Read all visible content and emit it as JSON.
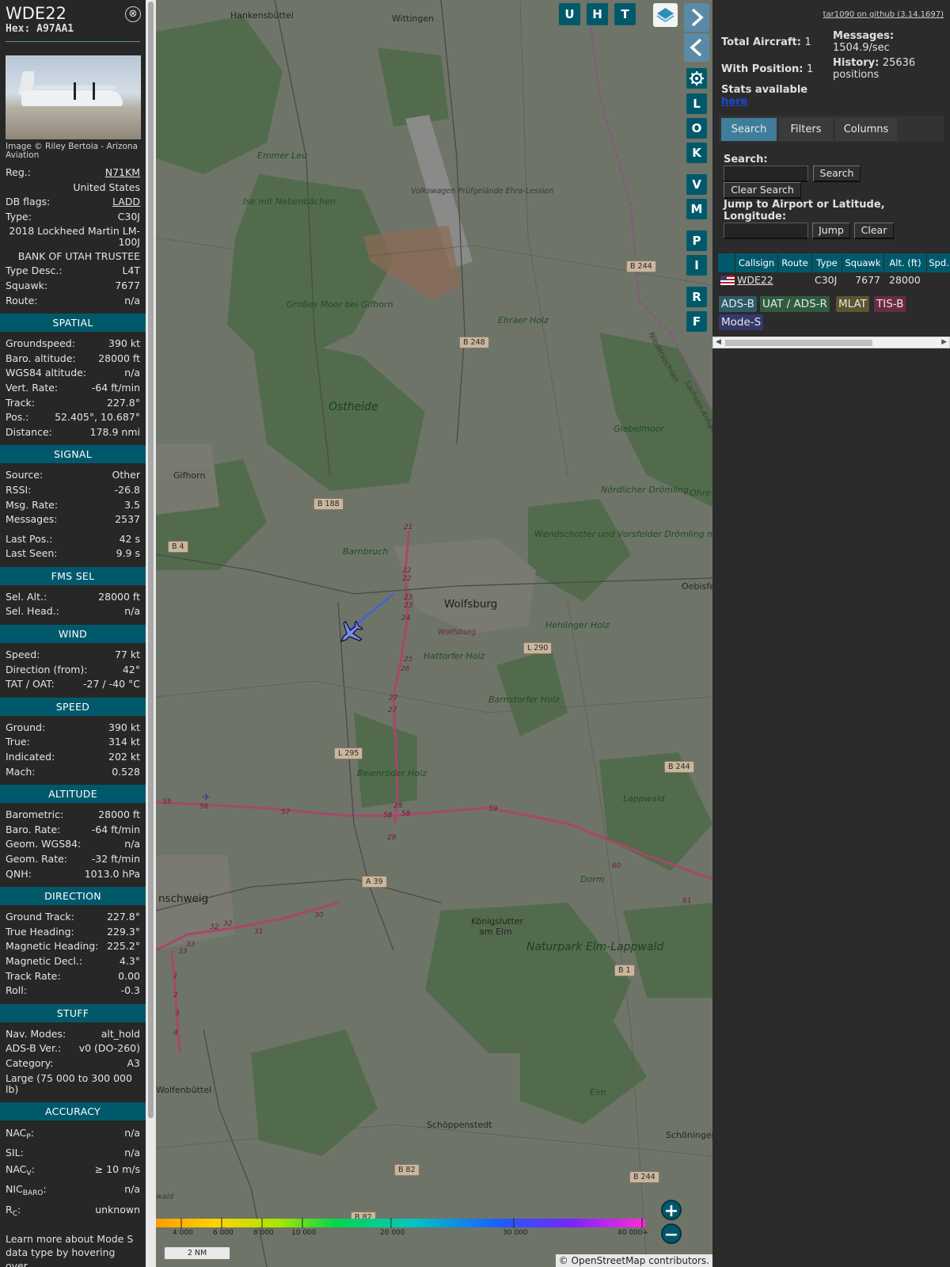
{
  "info": {
    "callsign": "WDE22",
    "hex": "Hex: A97AA1",
    "close_glyph": "⊗",
    "photo_credit": "Image © Riley Bertoia - Arizona Aviation",
    "top": [
      {
        "label": "Reg.:",
        "value": "N71KM",
        "link": true
      },
      {
        "label": "",
        "value": "United States"
      },
      {
        "label": "DB flags:",
        "value": "LADD",
        "link": true
      },
      {
        "label": "Type:",
        "value": "C30J"
      },
      {
        "label": "",
        "value": "2018 Lockheed Martin LM-100J"
      },
      {
        "label": "",
        "value": "BANK OF UTAH TRUSTEE"
      },
      {
        "label": "Type Desc.:",
        "value": "L4T"
      },
      {
        "label": "Squawk:",
        "value": "7677"
      },
      {
        "label": "Route:",
        "value": "n/a"
      }
    ],
    "spatial_title": "SPATIAL",
    "spatial": [
      {
        "label": "Groundspeed:",
        "value": "390 kt"
      },
      {
        "label": "Baro. altitude:",
        "value": "28000 ft"
      },
      {
        "label": "WGS84 altitude:",
        "value": "n/a"
      },
      {
        "label": "Vert. Rate:",
        "value": "-64 ft/min"
      },
      {
        "label": "Track:",
        "value": "227.8°"
      },
      {
        "label": "Pos.:",
        "value": "52.405°, 10.687°"
      },
      {
        "label": "Distance:",
        "value": "178.9 nmi"
      }
    ],
    "signal_title": "SIGNAL",
    "signal": [
      {
        "label": "Source:",
        "value": "Other"
      },
      {
        "label": "RSSI:",
        "value": "-26.8"
      },
      {
        "label": "Msg. Rate:",
        "value": "3.5"
      },
      {
        "label": "Messages:",
        "value": "2537"
      },
      {
        "label": "Last Pos.:",
        "value": "42 s"
      },
      {
        "label": "Last Seen:",
        "value": "9.9 s"
      }
    ],
    "fms_title": "FMS SEL",
    "fms": [
      {
        "label": "Sel. Alt.:",
        "value": "28000 ft"
      },
      {
        "label": "Sel. Head.:",
        "value": "n/a"
      }
    ],
    "wind_title": "WIND",
    "wind": [
      {
        "label": "Speed:",
        "value": "77 kt"
      },
      {
        "label": "Direction (from):",
        "value": "42°"
      },
      {
        "label": "TAT / OAT:",
        "value": "-27 / -40 °C"
      }
    ],
    "speed_title": "SPEED",
    "speed": [
      {
        "label": "Ground:",
        "value": "390 kt"
      },
      {
        "label": "True:",
        "value": "314 kt"
      },
      {
        "label": "Indicated:",
        "value": "202 kt"
      },
      {
        "label": "Mach:",
        "value": "0.528"
      }
    ],
    "altitude_title": "ALTITUDE",
    "altitude": [
      {
        "label": "Barometric:",
        "value": "28000 ft"
      },
      {
        "label": "Baro. Rate:",
        "value": "-64 ft/min"
      },
      {
        "label": "Geom. WGS84:",
        "value": "n/a"
      },
      {
        "label": "Geom. Rate:",
        "value": "-32 ft/min"
      },
      {
        "label": "QNH:",
        "value": "1013.0 hPa"
      }
    ],
    "direction_title": "DIRECTION",
    "direction": [
      {
        "label": "Ground Track:",
        "value": "227.8°"
      },
      {
        "label": "True Heading:",
        "value": "229.3°"
      },
      {
        "label": "Magnetic Heading:",
        "value": "225.2°"
      },
      {
        "label": "Magnetic Decl.:",
        "value": "4.3°"
      },
      {
        "label": "Track Rate:",
        "value": "0.00"
      },
      {
        "label": "Roll:",
        "value": "-0.3"
      }
    ],
    "stuff_title": "STUFF",
    "stuff": [
      {
        "label": "Nav. Modes:",
        "value": "alt_hold"
      },
      {
        "label": "ADS-B Ver.:",
        "value": "v0 (DO-260)"
      },
      {
        "label": "Category:",
        "value": "A3"
      },
      {
        "label": "Large (75 000 to 300 000 lb)",
        "value": ""
      }
    ],
    "accuracy_title": "ACCURACY",
    "accuracy": [
      {
        "label": "NAC",
        "sub": "P",
        "value": "n/a"
      },
      {
        "label": "SIL:",
        "sub": "",
        "value": "n/a"
      },
      {
        "label": "NAC",
        "sub": "V",
        "value": "≥ 10 m/s"
      },
      {
        "label": "NIC",
        "sub": "BARO",
        "value": "n/a"
      },
      {
        "label": "R",
        "sub": "C",
        "value": "unknown"
      }
    ],
    "learn_more": "Learn more about Mode S data type by hovering over"
  },
  "map": {
    "top_buttons": [
      "U",
      "H",
      "T"
    ],
    "side_buttons": [
      "L",
      "O",
      "K",
      "V",
      "M",
      "P",
      "I",
      "R",
      "F"
    ],
    "zoom_in": "+",
    "zoom_out": "−",
    "scale": "2 NM",
    "attribution": "© OpenStreetMap contributors.",
    "alt_ticks": [
      "4 000",
      "6 000",
      "8 000",
      "10 000",
      "20 000",
      "30 000",
      "40 000+"
    ],
    "places": {
      "hankensbuttel": "Hankensbüttel",
      "wittingen": "Wittingen",
      "emmer_leu": "Emmer Leu",
      "ise": "Ise mit Nebenbächen",
      "vw": "Volkswagen Prüfgelände Ehra-Lessien",
      "moor": "Großes Moor bei Gifhorn",
      "ehraer": "Ehraer Holz",
      "ostheide": "Ostheide",
      "giebelmoor": "Giebelmoor",
      "gifhorn": "Gifhorn",
      "drom": "Nördlicher Drömling",
      "ohre": "Ohre-",
      "barnbruch": "Barnbruch",
      "wend": "Wendschotter und Vorsfelder Drömling mit Kötherwiesen",
      "wolfsburg": "Wolfsburg",
      "wolfsburg_small": "Wolfsburg",
      "oebisfe": "Oebisfe",
      "hehlinger": "Hehlinger Holz",
      "hattorfer": "Hattorfer Holz",
      "barnstorfer": "Barnstorfer Holz",
      "beienroder": "Beienroder Holz",
      "lappwald": "Lappwald",
      "dorm": "Dorm",
      "braunschweig": "nschweig",
      "konigslutter": "Königslutter am Elm",
      "elm_lappwald": "Naturpark Elm-Lappwald",
      "wolfenbuttel": "Wolfenbüttel",
      "elm": "Elm",
      "schoppenstedt": "Schöppenstedt",
      "schoningen": "Schöningen",
      "niedersachsen": "Niedersachsen",
      "sachsen_anhalt": "Sachsen-Anhalt",
      "wald": "wald"
    },
    "roads": {
      "b244a": "B 244",
      "b248": "B 248",
      "b188": "B 188",
      "b4": "B 4",
      "l290": "L 290",
      "l295": "L 295",
      "b244b": "B 244",
      "a39": "A 39",
      "b1": "B 1",
      "b82a": "B 82",
      "b244c": "B 244",
      "b82b": "B 82"
    },
    "junctions": [
      "21",
      "22",
      "22",
      "23",
      "23",
      "24",
      "25",
      "26",
      "27",
      "27",
      "28",
      "58",
      "58",
      "29",
      "55",
      "56",
      "57",
      "59",
      "60",
      "61",
      "30",
      "31",
      "32",
      "32",
      "33",
      "33",
      "1",
      "2",
      "3",
      "4"
    ]
  },
  "right": {
    "github": "tar1090 on github (3.14.1697)",
    "total_aircraft_label": "Total Aircraft:",
    "total_aircraft": "1",
    "with_position_label": "With Position:",
    "with_position": "1",
    "stats_text": "Stats available",
    "stats_link": "here",
    "messages_label": "Messages:",
    "messages": "1504.9/sec",
    "history_label": "History:",
    "history": "25636 positions",
    "tabs": [
      "Search",
      "Filters",
      "Columns"
    ],
    "search_label": "Search:",
    "search_button": "Search",
    "clear_search_button": "Clear Search",
    "jump_label": "Jump to Airport or Latitude, Longitude:",
    "jump_button": "Jump",
    "clear_button": "Clear",
    "columns": [
      "Callsign",
      "Route",
      "Type",
      "Squawk",
      "Alt. (ft)",
      "Spd."
    ],
    "rows": [
      {
        "callsign": "WDE22",
        "route": "",
        "type": "C30J",
        "squawk": "7677",
        "alt": "28000",
        "spd": ""
      }
    ],
    "source_tags": [
      {
        "label": "ADS-B",
        "color": "#2e5a6b"
      },
      {
        "label": "UAT / ADS-R",
        "color": "#2f5c3d"
      },
      {
        "label": "MLAT",
        "color": "#5c5530"
      },
      {
        "label": "TIS-B",
        "color": "#6a2b45"
      },
      {
        "label": "Mode-S",
        "color": "#35386a"
      }
    ]
  }
}
